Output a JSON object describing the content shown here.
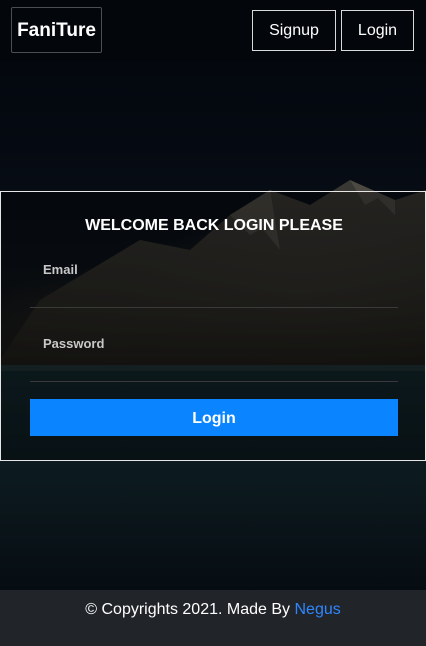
{
  "header": {
    "brand": "FaniTure",
    "signup_label": "Signup",
    "login_label": "Login"
  },
  "login_form": {
    "title": "WELCOME BACK LOGIN PLEASE",
    "email_label": "Email",
    "password_label": "Password",
    "email_value": "",
    "password_value": "",
    "submit_label": "Login"
  },
  "footer": {
    "text": "© Copyrights 2021. Made By",
    "author_link": "Negus"
  },
  "colors": {
    "accent": "#0a84ff",
    "footer_bg": "#212529",
    "link": "#2f86ff"
  }
}
